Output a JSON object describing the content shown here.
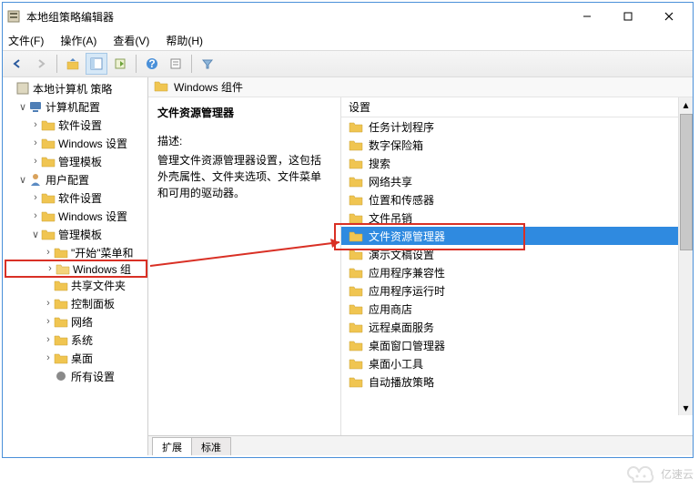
{
  "window": {
    "title": "本地组策略编辑器"
  },
  "menu": {
    "file": "文件(F)",
    "action": "操作(A)",
    "view": "查看(V)",
    "help": "帮助(H)"
  },
  "tree": {
    "root": "本地计算机 策略",
    "computer_config": "计算机配置",
    "cc_software": "软件设置",
    "cc_windows": "Windows 设置",
    "cc_admin": "管理模板",
    "user_config": "用户配置",
    "uc_software": "软件设置",
    "uc_windows": "Windows 设置",
    "uc_admin": "管理模板",
    "uc_start": "\"开始\"菜单和",
    "uc_win_comp": "Windows 组",
    "uc_shared": "共享文件夹",
    "uc_control": "控制面板",
    "uc_network": "网络",
    "uc_system": "系统",
    "uc_desktop": "桌面",
    "uc_all": "所有设置"
  },
  "right": {
    "header": "Windows 组件",
    "detail_title": "文件资源管理器",
    "desc_label": "描述:",
    "desc": "管理文件资源管理器设置，这包括外壳属性、文件夹选项、文件菜单和可用的驱动器。",
    "col_setting": "设置",
    "items": [
      "任务计划程序",
      "数字保险箱",
      "搜索",
      "网络共享",
      "位置和传感器",
      "文件吊销",
      "文件资源管理器",
      "演示文稿设置",
      "应用程序兼容性",
      "应用程序运行时",
      "应用商店",
      "远程桌面服务",
      "桌面窗口管理器",
      "桌面小工具",
      "自动播放策略"
    ],
    "selected_index": 6,
    "tab_extended": "扩展",
    "tab_standard": "标准"
  },
  "watermark": "亿速云"
}
